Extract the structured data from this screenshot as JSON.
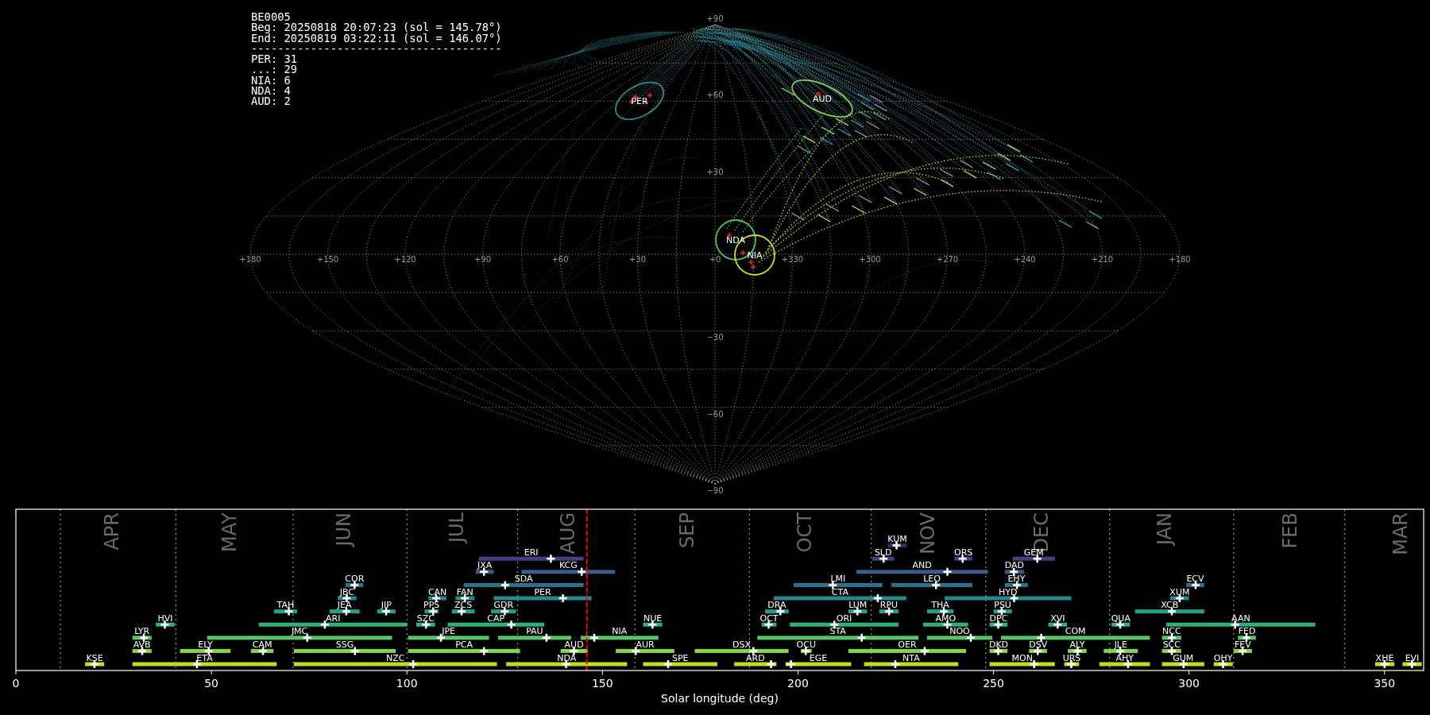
{
  "info": {
    "header": [
      "BE0005",
      "Beg: 20250818 20:07:23 (sol = 145.78°)",
      "End: 20250819 03:22:11 (sol = 146.07°)"
    ],
    "divider": "--------------------------------------",
    "counts": [
      "PER: 31",
      "...: 29",
      "NIA: 6",
      "NDA: 4",
      "AUD: 2"
    ]
  },
  "sky_map": {
    "longitude_labels": [
      "+180",
      "+150",
      "+120",
      "+90",
      "+60",
      "+30",
      "+0",
      "+330",
      "+300",
      "+270",
      "+240",
      "+210",
      "+180"
    ],
    "latitude_labels": [
      "+90",
      "+60",
      "+30",
      "−30",
      "−60",
      "−90"
    ],
    "radiants": [
      {
        "label": "PER",
        "color": "#21918c"
      },
      {
        "label": "AUD",
        "color": "#7ad151"
      },
      {
        "label": "NDA",
        "color": "#4ec36b"
      },
      {
        "label": "NIA",
        "color": "#c8e020"
      }
    ]
  },
  "timeline": {
    "months": [
      "APR",
      "MAY",
      "JUN",
      "JUL",
      "AUG",
      "SEP",
      "OCT",
      "NOV",
      "DEC",
      "JAN",
      "FEB",
      "MAR"
    ],
    "lanes": [
      {
        "color": "#48216f",
        "showers": [
          "KUM"
        ]
      },
      {
        "color": "#453f88",
        "showers": [
          "ERI",
          "SLD",
          "ORS",
          "GEM"
        ]
      },
      {
        "color": "#3b5b8b",
        "showers": [
          "JXA",
          "KCG",
          "AND",
          "DAD"
        ]
      },
      {
        "color": "#2c728e",
        "showers": [
          "COR",
          "SDA",
          "LMI",
          "LEO",
          "EHY",
          "ECV"
        ]
      },
      {
        "color": "#23898e",
        "showers": [
          "JBC",
          "CAN",
          "FAN",
          "PER",
          "CTA",
          "HYD",
          "XUM"
        ]
      },
      {
        "color": "#1fa187",
        "showers": [
          "TAH",
          "JEA",
          "JIP",
          "PPS",
          "ZCS",
          "GDR",
          "DRA",
          "LUM",
          "RPU",
          "THA",
          "PSU",
          "XCB"
        ]
      },
      {
        "color": "#2db27d",
        "showers": [
          "HVI",
          "ARI",
          "SZC",
          "CAP",
          "NUE",
          "OCT",
          "ORI",
          "AMO",
          "DPC",
          "XVI",
          "QUA",
          "AAN"
        ]
      },
      {
        "color": "#54c568",
        "showers": [
          "LYR",
          "JMC",
          "JPE",
          "PAU",
          "NIA",
          "STA",
          "NOO",
          "COM",
          "NCC",
          "FED"
        ]
      },
      {
        "color": "#86d549",
        "showers": [
          "AVB",
          "ELY",
          "CAM",
          "SSG",
          "PCA",
          "AUD",
          "AUR",
          "DSX",
          "OCU",
          "OER",
          "DKD",
          "DSV",
          "ALY",
          "JLE",
          "SCC",
          "FEV"
        ]
      },
      {
        "color": "#bddf26",
        "showers": [
          "KSE",
          "ETA",
          "NZC",
          "NDA",
          "SPE",
          "ARD",
          "EGE",
          "NTA",
          "MON",
          "URS",
          "AHY",
          "GUM",
          "OHY",
          "XHE",
          "EVI"
        ]
      }
    ],
    "x_ticks": [
      "0",
      "50",
      "100",
      "150",
      "200",
      "250",
      "300",
      "350"
    ],
    "x_label": "Solar longitude (deg)"
  }
}
